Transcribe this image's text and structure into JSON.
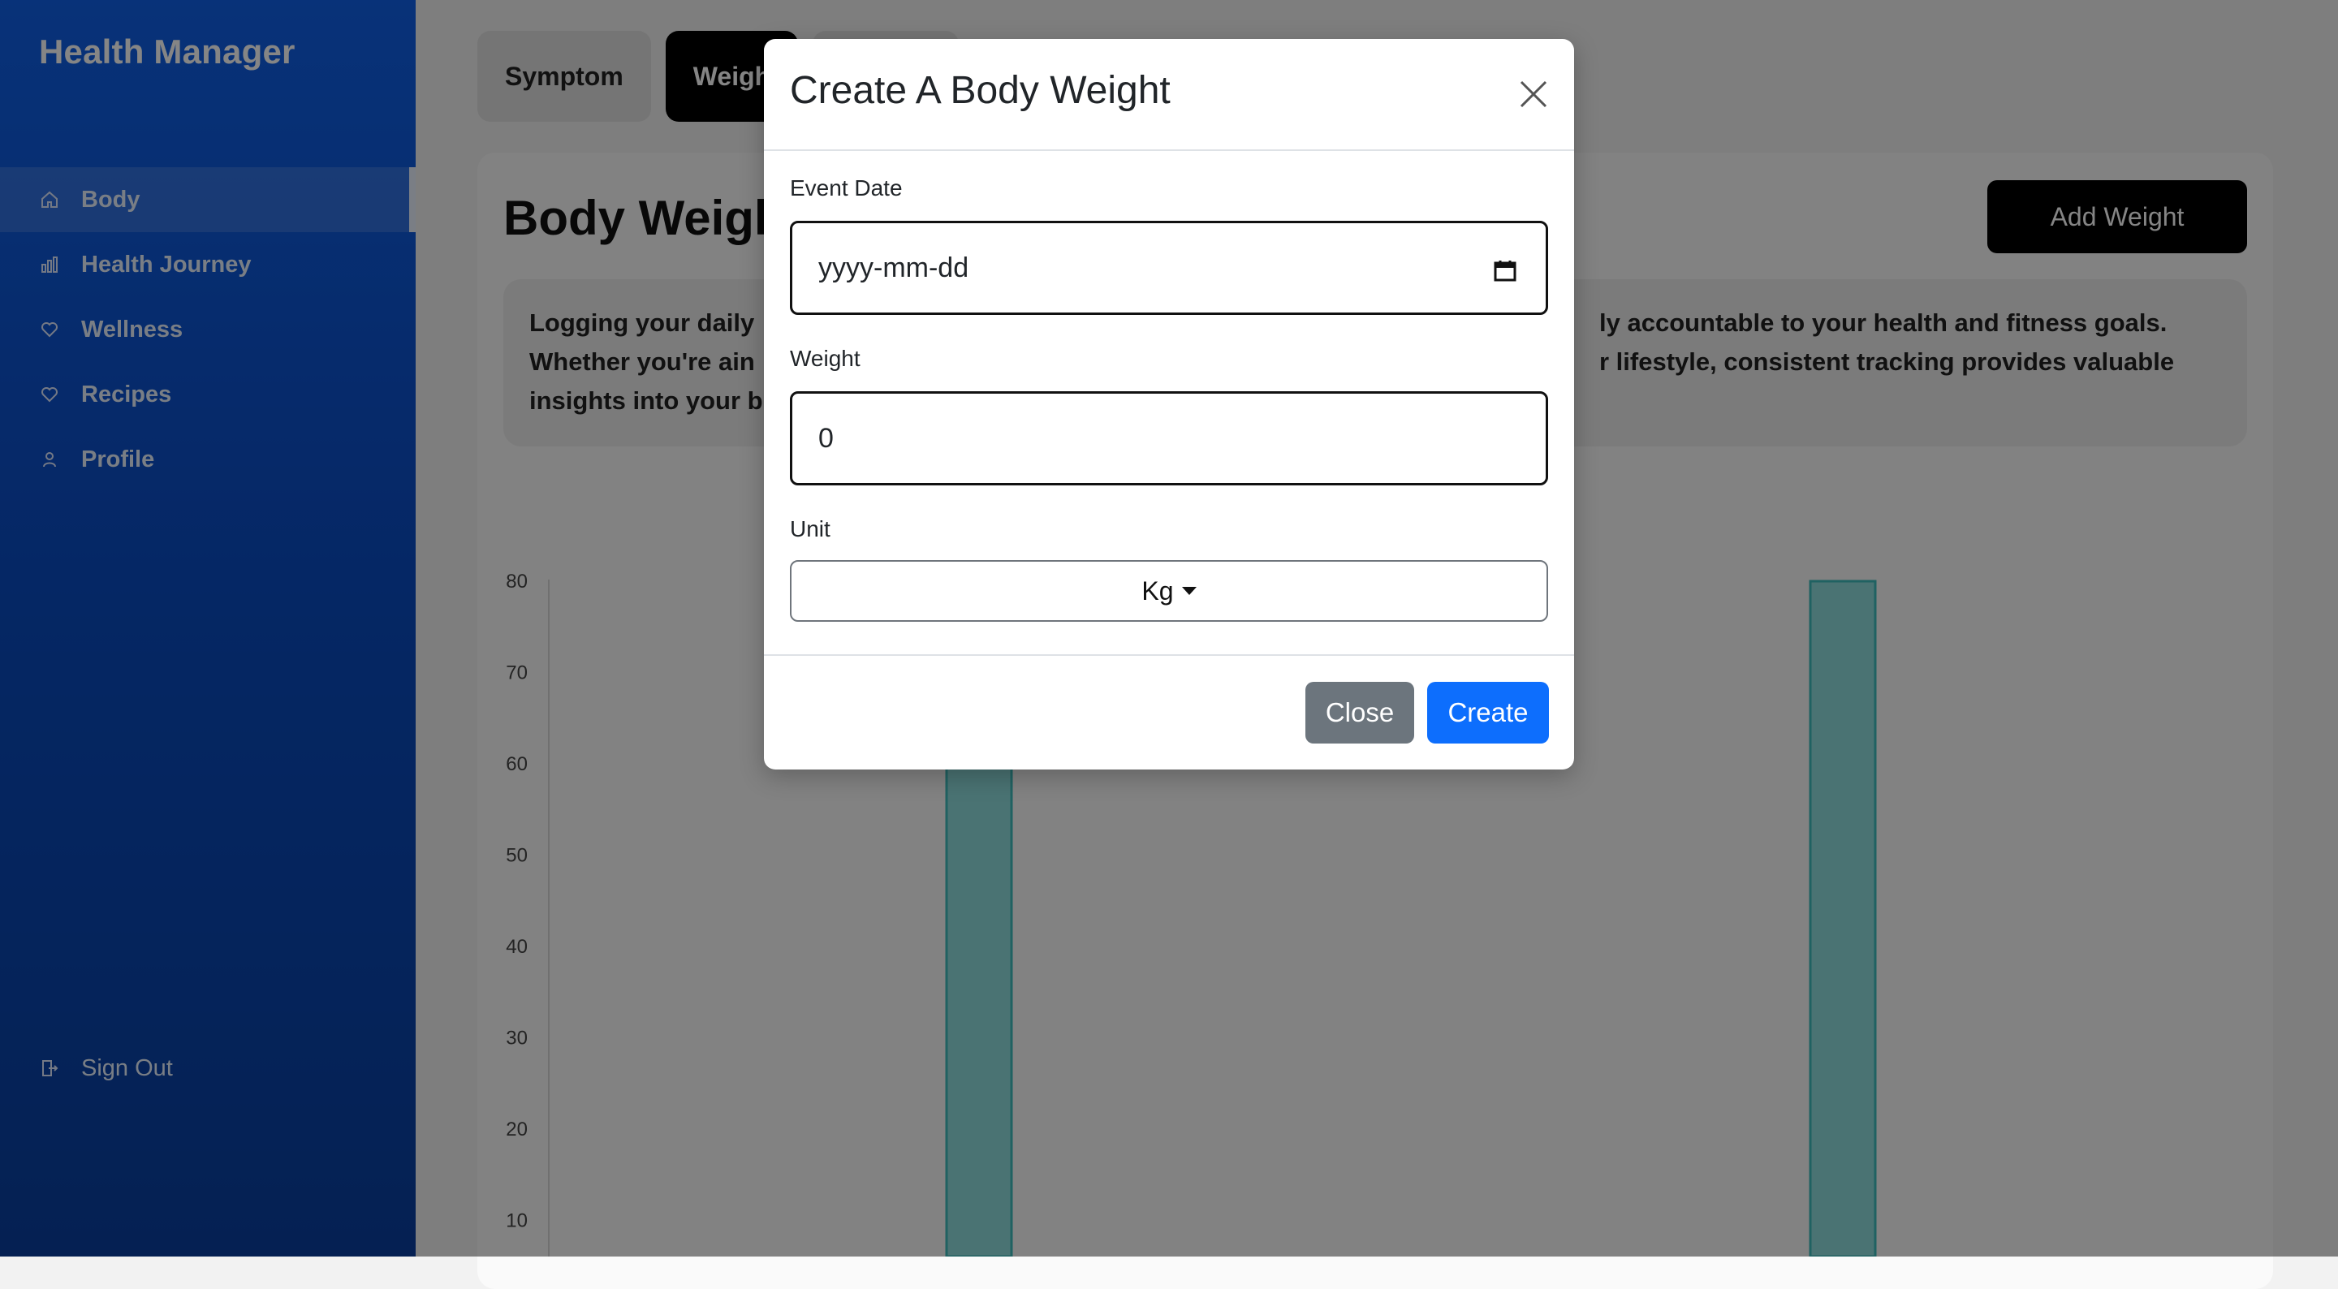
{
  "app": {
    "brand": "Health Manager"
  },
  "sidebar": {
    "items": [
      {
        "label": "Body",
        "icon": "home-icon",
        "active": true
      },
      {
        "label": "Health Journey",
        "icon": "bar-chart-icon",
        "active": false
      },
      {
        "label": "Wellness",
        "icon": "heart-icon",
        "active": false
      },
      {
        "label": "Recipes",
        "icon": "heart-icon",
        "active": false
      },
      {
        "label": "Profile",
        "icon": "user-icon",
        "active": false
      }
    ],
    "sign_out": "Sign Out"
  },
  "tabs": [
    {
      "label": "Symptom",
      "active": false
    },
    {
      "label": "Weigh",
      "active": true
    }
  ],
  "main": {
    "title": "Body Weigh",
    "add_button": "Add Weight",
    "info_lines": [
      "Logging your daily",
      "Whether you're ain",
      "insights into your b",
      "ly accountable to your health and fitness goals.",
      "r lifestyle, consistent tracking provides valuable"
    ]
  },
  "chart_data": {
    "type": "bar",
    "y_ticks": [
      80,
      70,
      60,
      50,
      40,
      30,
      20,
      10
    ],
    "ylim": [
      0,
      80
    ],
    "bars": [
      {
        "value": 80
      },
      {
        "value": 80
      }
    ],
    "bar_color": "#8fdcdc"
  },
  "modal": {
    "title": "Create A Body Weight",
    "event_date_label": "Event Date",
    "event_date_placeholder": "yyyy-mm-dd",
    "weight_label": "Weight",
    "weight_value": "0",
    "unit_label": "Unit",
    "unit_value": "Kg",
    "close_button": "Close",
    "create_button": "Create"
  },
  "colors": {
    "sidebar": "#0b4cc2",
    "primary": "#0d6efd",
    "secondary": "#6c757d"
  }
}
